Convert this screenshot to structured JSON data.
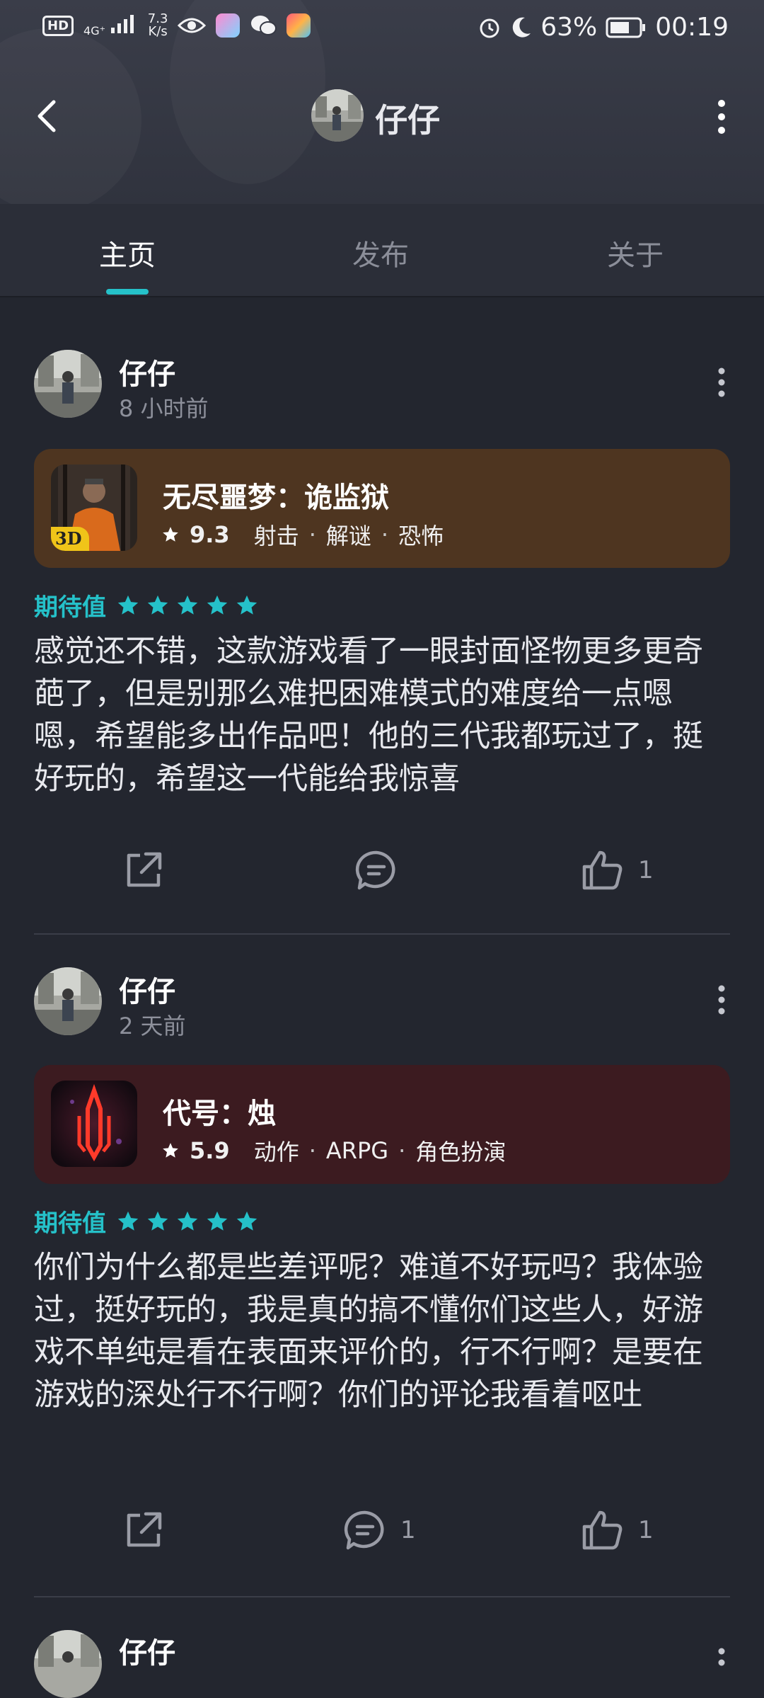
{
  "status_bar": {
    "hd_badge": "HD",
    "signal": "4G⁺",
    "speed_value": "7.3",
    "speed_unit": "K/s",
    "battery": "63%",
    "time": "00:19"
  },
  "nav": {
    "title": "仔仔"
  },
  "tabs": [
    {
      "label": "主页",
      "active": true
    },
    {
      "label": "发布",
      "active": false
    },
    {
      "label": "关于",
      "active": false
    }
  ],
  "posts": [
    {
      "user": "仔仔",
      "time": "8 小时前",
      "game": {
        "name": "无尽噩梦：诡监狱",
        "score": "9.3",
        "tags": [
          "射击",
          "解谜",
          "恐怖"
        ],
        "badge": "3D",
        "card_color": "#4e3520"
      },
      "expect_label": "期待值",
      "stars": 5,
      "text": "感觉还不错，这款游戏看了一眼封面怪物更多更奇葩了，但是别那么难把困难模式的难度给一点嗯嗯，希望能多出作品吧！他的三代我都玩过了，挺好玩的，希望这一代能给我惊喜",
      "comments": "",
      "likes": "1"
    },
    {
      "user": "仔仔",
      "time": "2 天前",
      "game": {
        "name": "代号：烛",
        "score": "5.9",
        "tags": [
          "动作",
          "ARPG",
          "角色扮演"
        ],
        "card_color": "#3c1b20"
      },
      "expect_label": "期待值",
      "stars": 5,
      "text": "你们为什么都是些差评呢？难道不好玩吗？我体验过，挺好玩的，我是真的搞不懂你们这些人，好游戏不单纯是看在表面来评价的，行不行啊？是要在游戏的深处行不行啊？你们的评论我看着呕吐",
      "comments": "1",
      "likes": "1"
    },
    {
      "user": "仔仔"
    }
  ],
  "colors": {
    "accent": "#25c1c9",
    "background": "#23262f",
    "header": "#353844"
  }
}
